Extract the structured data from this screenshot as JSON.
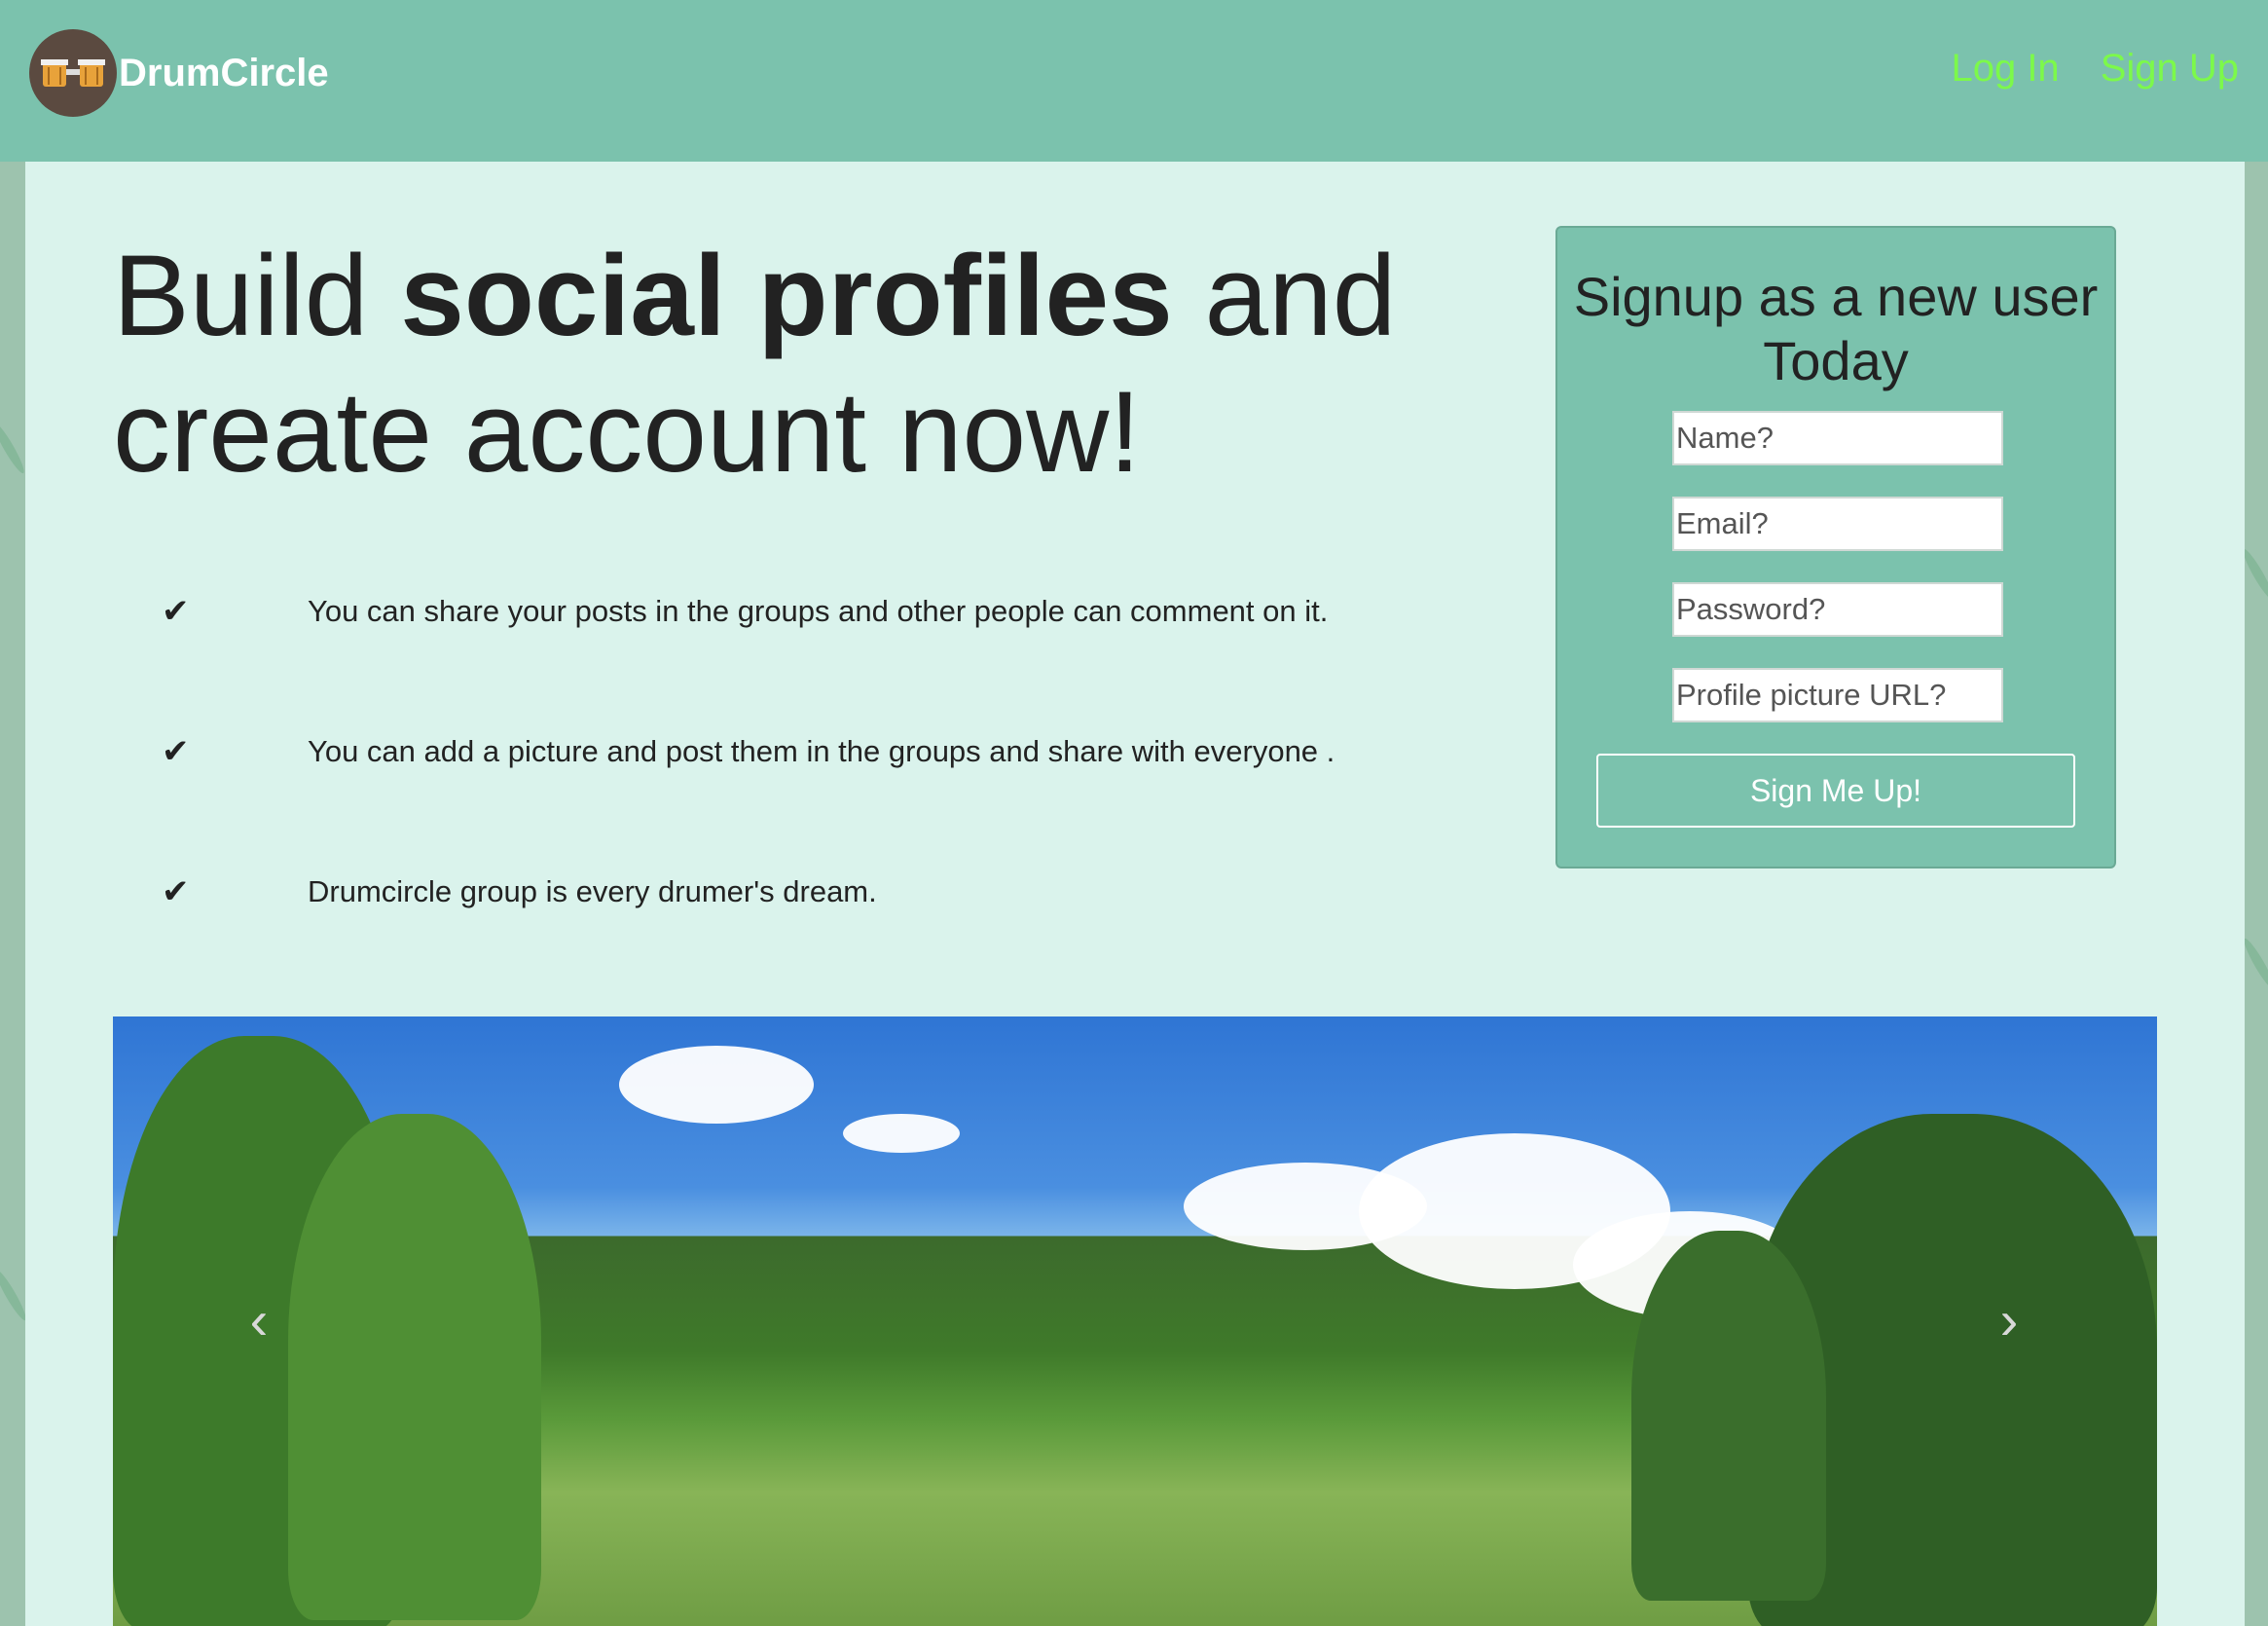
{
  "brand": {
    "name": "DrumCircle",
    "logo_icon": "bongo-drums-icon"
  },
  "nav": {
    "login": "Log In",
    "signup": "Sign Up"
  },
  "hero": {
    "headline_part1": "Build ",
    "headline_bold": "social profiles",
    "headline_part2": " and create account now!"
  },
  "features": [
    "You can share your posts in the groups and other people can comment on it.",
    "You can add a picture and post them in the groups and share with everyone .",
    "Drumcircle group is every drumer's dream."
  ],
  "signup_form": {
    "title": "Signup as a new user Today",
    "name_placeholder": "Name?",
    "email_placeholder": "Email?",
    "password_placeholder": "Password?",
    "picture_placeholder": "Profile picture URL?",
    "submit_label": "Sign Me Up!"
  },
  "carousel": {
    "prev_icon": "chevron-left-icon",
    "next_icon": "chevron-right-icon"
  },
  "colors": {
    "navbar": "#7bc2ad",
    "nav_link": "#7cf94a",
    "content_bg": "#daf3ec"
  }
}
